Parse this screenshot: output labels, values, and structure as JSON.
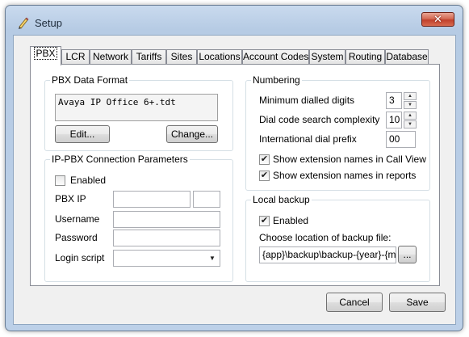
{
  "window": {
    "title": "Setup",
    "close_glyph": "✕"
  },
  "icons": {
    "app": "pencil-icon",
    "close": "close-icon",
    "dropdown": "chevron-down-icon",
    "spin": "spin-arrows-icon",
    "check": "checkmark-icon"
  },
  "tabs": [
    {
      "label": "PBX",
      "active": true
    },
    {
      "label": "LCR"
    },
    {
      "label": "Network"
    },
    {
      "label": "Tariffs"
    },
    {
      "label": "Sites"
    },
    {
      "label": "Locations"
    },
    {
      "label": "Account Codes"
    },
    {
      "label": "System"
    },
    {
      "label": "Routing"
    },
    {
      "label": "Database"
    }
  ],
  "pbx_format": {
    "title": "PBX Data Format",
    "value": "Avaya IP Office 6+.tdt",
    "edit_label": "Edit...",
    "change_label": "Change..."
  },
  "ippbx": {
    "title": "IP-PBX Connection Parameters",
    "enabled_label": "Enabled",
    "enabled": false,
    "pbx_ip_label": "PBX IP",
    "pbx_ip_value": "",
    "port_value": "",
    "username_label": "Username",
    "username_value": "",
    "password_label": "Password",
    "password_value": "",
    "login_script_label": "Login script",
    "login_script_value": ""
  },
  "numbering": {
    "title": "Numbering",
    "min_digits_label": "Minimum dialled digits",
    "min_digits_value": "3",
    "complexity_label": "Dial code search complexity",
    "complexity_value": "10",
    "intl_prefix_label": "International dial prefix",
    "intl_prefix_value": "00",
    "show_call_view_label": "Show extension names in Call View",
    "show_call_view": true,
    "show_reports_label": "Show extension names in reports",
    "show_reports": true
  },
  "backup": {
    "title": "Local backup",
    "enabled_label": "Enabled",
    "enabled": true,
    "location_label": "Choose location of backup file:",
    "location_value": "{app}\\backup\\backup-{year}-{mor",
    "browse_label": "..."
  },
  "footer": {
    "cancel_label": "Cancel",
    "save_label": "Save"
  }
}
